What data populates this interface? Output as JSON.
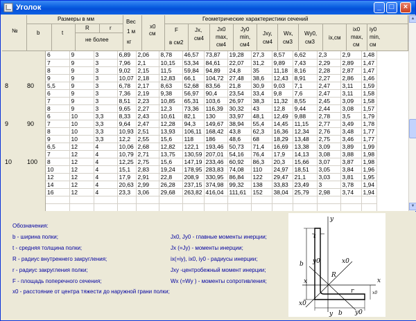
{
  "window": {
    "title": "Уголок",
    "minimize": "_",
    "maximize": "□",
    "close": "×"
  },
  "header": {
    "num": "№",
    "sizes_group": "Размеры в мм",
    "b": "b",
    "t": "t",
    "R": "R",
    "r": "r",
    "not_more": "не более",
    "weight_1": "Вес",
    "weight_2": "1 м",
    "weight_3": "кг",
    "x0_1": "x0",
    "x0_2": "см",
    "geo_group": "Геометрические характеристики сечений",
    "F_1": "F",
    "F_2": "в см2",
    "Jx_1": "Jx,",
    "Jx_2": "см4",
    "Jx0_1": "Jx0",
    "Jx0_2": "max,",
    "Jx0_3": "см4",
    "Jy0_1": "Jy0",
    "Jy0_2": "min,",
    "Jy0_3": "см4",
    "Jxy_1": "Jxy,",
    "Jxy_2": "см4",
    "Wx_1": "Wx,",
    "Wx_2": "см3",
    "Wy0_1": "Wy0,",
    "Wy0_2": "см3",
    "ix_1": "ix,см",
    "ix0_1": "ix0",
    "ix0_2": "max,",
    "ix0_3": "см",
    "iy0_1": "iy0",
    "iy0_2": "min,",
    "iy0_3": "см"
  },
  "row_headers": [
    {
      "num": "",
      "b": ""
    },
    {
      "num": "",
      "b": ""
    },
    {
      "num": "",
      "b": ""
    },
    {
      "num": "",
      "b": ""
    },
    {
      "num": "8",
      "b": "80"
    },
    {
      "num": "",
      "b": ""
    },
    {
      "num": "",
      "b": ""
    },
    {
      "num": "",
      "b": ""
    },
    {
      "num": "",
      "b": ""
    },
    {
      "num": "9",
      "b": "90"
    },
    {
      "num": "",
      "b": ""
    },
    {
      "num": "",
      "b": ""
    },
    {
      "num": "",
      "b": ""
    },
    {
      "num": "",
      "b": ""
    },
    {
      "num": "10",
      "b": "100"
    },
    {
      "num": "",
      "b": ""
    },
    {
      "num": "",
      "b": ""
    },
    {
      "num": "",
      "b": ""
    },
    {
      "num": "",
      "b": ""
    },
    {
      "num": "",
      "b": ""
    },
    {
      "num": "",
      "b": ""
    },
    {
      "num": "",
      "b": ""
    }
  ],
  "rows": [
    [
      "6",
      "9",
      "3",
      "6,89",
      "2,06",
      "8,78",
      "46,57",
      "73,87",
      "19,28",
      "27,3",
      "8,57",
      "6,62",
      "2,3",
      "2,9",
      "1,48"
    ],
    [
      "7",
      "9",
      "3",
      "7,96",
      "2,1",
      "10,15",
      "53,34",
      "84,61",
      "22,07",
      "31,2",
      "9,89",
      "7,43",
      "2,29",
      "2,89",
      "1,47"
    ],
    [
      "8",
      "9",
      "3",
      "9,02",
      "2,15",
      "11,5",
      "59,84",
      "94,89",
      "24,8",
      "35",
      "11,18",
      "8,16",
      "2,28",
      "2,87",
      "1,47"
    ],
    [
      "9",
      "9",
      "3",
      "10,07",
      "2,18",
      "12,83",
      "66,1",
      "104,72",
      "27,48",
      "38,6",
      "12,43",
      "8,91",
      "2,27",
      "2,86",
      "1,46"
    ],
    [
      "5,5",
      "9",
      "3",
      "6,78",
      "2,17",
      "8,63",
      "52,68",
      "83,56",
      "21,8",
      "30,9",
      "9,03",
      "7,1",
      "2,47",
      "3,11",
      "1,59"
    ],
    [
      "6",
      "9",
      "3",
      "7,36",
      "2,19",
      "9,38",
      "56,97",
      "90,4",
      "23,54",
      "33,4",
      "9,8",
      "7,6",
      "2,47",
      "3,11",
      "1,58"
    ],
    [
      "7",
      "9",
      "3",
      "8,51",
      "2,23",
      "10,85",
      "65,31",
      "103,6",
      "26,97",
      "38,3",
      "11,32",
      "8,55",
      "2,45",
      "3,09",
      "1,58"
    ],
    [
      "8",
      "9",
      "3",
      "9,65",
      "2,27",
      "12,3",
      "73,36",
      "116,39",
      "30,32",
      "43",
      "12,8",
      "9,44",
      "2,44",
      "3,08",
      "1,57"
    ],
    [
      "6",
      "10",
      "3,3",
      "8,33",
      "2,43",
      "10,61",
      "82,1",
      "130",
      "33,97",
      "48,1",
      "12,49",
      "9,88",
      "2,78",
      "3,5",
      "1,79"
    ],
    [
      "7",
      "10",
      "3,3",
      "9,64",
      "2,47",
      "12,28",
      "94,3",
      "149,67",
      "38,94",
      "55,4",
      "14,45",
      "11,15",
      "2,77",
      "3,49",
      "1,78"
    ],
    [
      "8",
      "10",
      "3,3",
      "10,93",
      "2,51",
      "13,93",
      "106,11",
      "168,42",
      "43,8",
      "62,3",
      "16,36",
      "12,34",
      "2,76",
      "3,48",
      "1,77"
    ],
    [
      "9",
      "10",
      "3,3",
      "12,2",
      "2,55",
      "15,6",
      "118",
      "186",
      "48,6",
      "68",
      "18,29",
      "13,48",
      "2,75",
      "3,46",
      "1,77"
    ],
    [
      "6,5",
      "12",
      "4",
      "10,06",
      "2,68",
      "12,82",
      "122,1",
      "193,46",
      "50,73",
      "71,4",
      "16,69",
      "13,38",
      "3,09",
      "3,89",
      "1,99"
    ],
    [
      "7",
      "12",
      "4",
      "10,79",
      "2,71",
      "13,75",
      "130,59",
      "207,01",
      "54,16",
      "76,4",
      "17,9",
      "14,13",
      "3,08",
      "3,88",
      "1,98"
    ],
    [
      "8",
      "12",
      "4",
      "12,25",
      "2,75",
      "15,6",
      "147,19",
      "233,46",
      "60,92",
      "86,3",
      "20,3",
      "15,66",
      "3,07",
      "3,87",
      "1,98"
    ],
    [
      "10",
      "12",
      "4",
      "15,1",
      "2,83",
      "19,24",
      "178,95",
      "283,83",
      "74,08",
      "110",
      "24,97",
      "18,51",
      "3,05",
      "3,84",
      "1,96"
    ],
    [
      "12",
      "12",
      "4",
      "17,9",
      "2,91",
      "22,8",
      "208,9",
      "330,95",
      "86,84",
      "122",
      "29,47",
      "21,1",
      "3,03",
      "3,81",
      "1,95"
    ],
    [
      "14",
      "12",
      "4",
      "20,63",
      "2,99",
      "26,28",
      "237,15",
      "374,98",
      "99,32",
      "138",
      "33,83",
      "23,49",
      "3",
      "3,78",
      "1,94"
    ],
    [
      "16",
      "12",
      "4",
      "23,3",
      "3,06",
      "29,68",
      "263,82",
      "416,04",
      "111,61",
      "152",
      "38,04",
      "25,79",
      "2,98",
      "3,74",
      "1,94"
    ],
    [
      "",
      "",
      "",
      "",
      "",
      "",
      "",
      "",
      "",
      "",
      "",
      "",
      "",
      "",
      ""
    ],
    [
      "",
      "",
      "",
      "",
      "",
      "",
      "",
      "",
      "",
      "",
      "",
      "",
      "",
      "",
      ""
    ],
    [
      "",
      "",
      "",
      "",
      "",
      "",
      "",
      "",
      "",
      "",
      "",
      "",
      "",
      "",
      ""
    ]
  ],
  "legend": {
    "title": "Обозначения:",
    "b": "b - ширина полки;",
    "t": "t - средняя толщина полки;",
    "R": "R - радиус внутреннего закругления;",
    "r": "r - радиус закругления полки;",
    "F": "F - площадь поперечного сечения;",
    "x0": "x0  - расстояние от центра тяжести до наружной грани полки;",
    "J0": "Jx0, Jy0 - главные моменты инерции;",
    "Jx": "Jx (=Jy) - моменты инерции;",
    "i": "ix(=iy), ix0, iy0 - радиусы инерции;",
    "Jxy": "Jxy -центробежный момент инерции;",
    "Wx": "Wx (=Wy ) - моменты сопротивления;"
  },
  "figure": {
    "y": "y",
    "t": "t",
    "y0": "y0",
    "x0_top": "x0",
    "b_left": "b",
    "x_left": "x",
    "x_right": "x",
    "r": "r",
    "R": "R",
    "x0_dim": "x0",
    "x0_bottom": "x0",
    "y_bottom": "y",
    "y0_bottom": "y0",
    "b_bottom": "b"
  }
}
